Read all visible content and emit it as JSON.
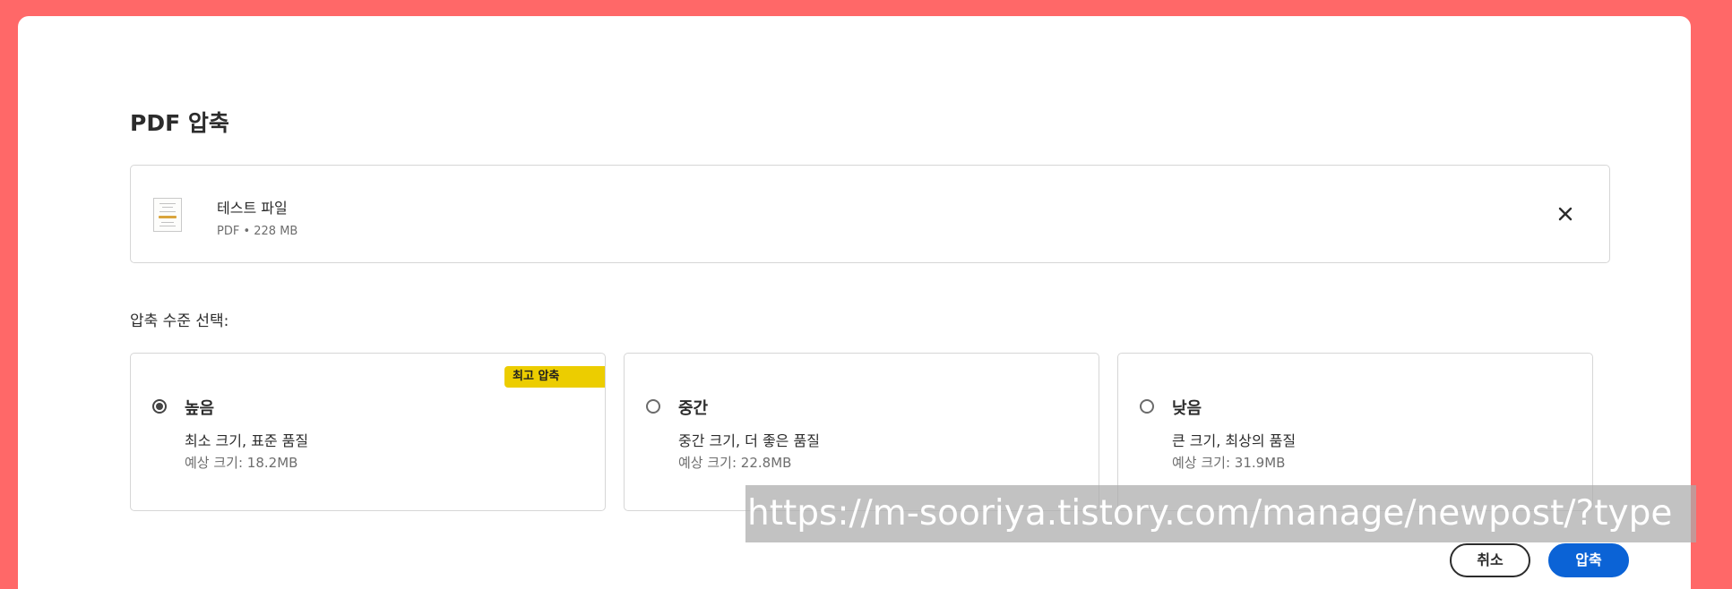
{
  "dialog": {
    "title": "PDF 압축"
  },
  "file": {
    "name": "테스트 파일",
    "meta": "PDF • 228 MB"
  },
  "section_label": "압축 수준 선택:",
  "options": [
    {
      "title": "높음",
      "description": "최소 크기, 표준 품질",
      "estimate": "예상 크기: 18.2MB",
      "badge": "최고 압축",
      "selected": true
    },
    {
      "title": "중간",
      "description": "중간 크기, 더 좋은 품질",
      "estimate": "예상 크기: 22.8MB",
      "selected": false
    },
    {
      "title": "낮음",
      "description": "큰 크기, 최상의 품질",
      "estimate": "예상 크기: 31.9MB",
      "selected": false
    }
  ],
  "buttons": {
    "cancel": "취소",
    "compress": "압축"
  },
  "watermark": "https://m-sooriya.tistory.com/manage/newpost/?type",
  "colors": {
    "background": "#ff6868",
    "badge": "#eccd00",
    "primary": "#0b63d6"
  },
  "icons": {
    "close": "close-icon",
    "file_thumbnail": "pdf-thumbnail"
  }
}
